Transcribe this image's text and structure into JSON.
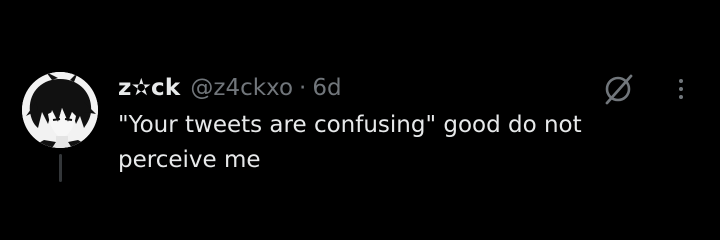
{
  "tweet": {
    "display_name": "z✫ck",
    "handle": "@z4ckxo",
    "separator": "·",
    "time": "6d",
    "text": "\"Your tweets are confusing\" good do not perceive me"
  },
  "icons": {
    "avatar": "user-avatar-manga-portrait",
    "grok": "grok-icon",
    "more": "more-options-icon"
  },
  "colors": {
    "background": "#000000",
    "primary_text": "#e7e9ea",
    "secondary_text": "#71767b",
    "thread_line": "#333639"
  }
}
